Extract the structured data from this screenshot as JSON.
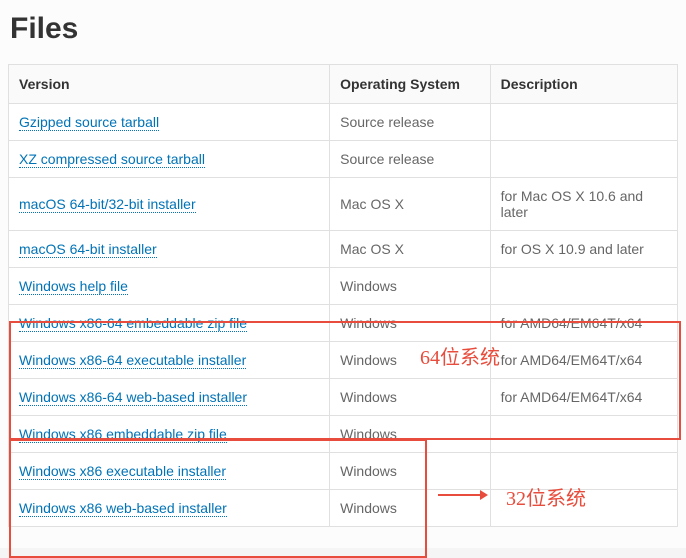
{
  "heading": "Files",
  "columns": [
    "Version",
    "Operating System",
    "Description"
  ],
  "rows": [
    {
      "version": "Gzipped source tarball",
      "os": "Source release",
      "desc": ""
    },
    {
      "version": "XZ compressed source tarball",
      "os": "Source release",
      "desc": ""
    },
    {
      "version": "macOS 64-bit/32-bit installer",
      "os": "Mac OS X",
      "desc": "for Mac OS X 10.6 and later"
    },
    {
      "version": "macOS 64-bit installer",
      "os": "Mac OS X",
      "desc": "for OS X 10.9 and later"
    },
    {
      "version": "Windows help file",
      "os": "Windows",
      "desc": ""
    },
    {
      "version": "Windows x86-64 embeddable zip file",
      "os": "Windows",
      "desc": "for AMD64/EM64T/x64"
    },
    {
      "version": "Windows x86-64 executable installer",
      "os": "Windows",
      "desc": "for AMD64/EM64T/x64"
    },
    {
      "version": "Windows x86-64 web-based installer",
      "os": "Windows",
      "desc": "for AMD64/EM64T/x64"
    },
    {
      "version": "Windows x86 embeddable zip file",
      "os": "Windows",
      "desc": ""
    },
    {
      "version": "Windows x86 executable installer",
      "os": "Windows",
      "desc": ""
    },
    {
      "version": "Windows x86 web-based installer",
      "os": "Windows",
      "desc": ""
    }
  ],
  "annotations": {
    "label64": "64位系统",
    "label32": "32位系统"
  }
}
